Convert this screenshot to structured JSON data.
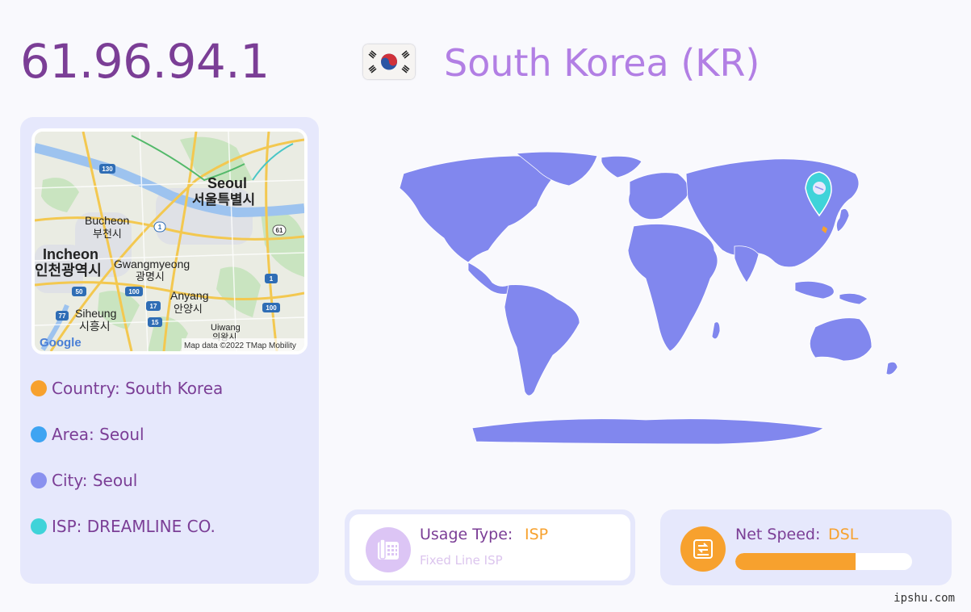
{
  "header": {
    "ip": "61.96.94.1",
    "country_title": "South Korea (KR)",
    "flag_icon": "south-korea-flag-icon"
  },
  "mini_map": {
    "labels": {
      "seoul": "Seoul",
      "seoul_kr": "서울특별시",
      "bucheon": "Bucheon",
      "bucheon_kr": "부천시",
      "incheon": "Incheon",
      "incheon_kr": "인천광역시",
      "gwangmyeong": "Gwangmyeong",
      "gwangmyeong_kr": "광명시",
      "anyang": "Anyang",
      "anyang_kr": "안양시",
      "siheung": "Siheung",
      "siheung_kr": "시흥시",
      "uiwang": "Uiwang",
      "uiwang_kr": "의왕시"
    },
    "route_shields": [
      "130",
      "1",
      "61",
      "1",
      "50",
      "100",
      "17",
      "100",
      "77",
      "15"
    ],
    "logo": "Google",
    "attribution": "Map data ©2022 TMap Mobility"
  },
  "info": {
    "country": "Country: South Korea",
    "area": "Area: Seoul",
    "city": "City: Seoul",
    "isp": "ISP: DREAMLINE CO."
  },
  "usage": {
    "label": "Usage Type:",
    "value": "ISP",
    "sub": "Fixed Line ISP",
    "icon": "phone-icon"
  },
  "speed": {
    "label": "Net Speed:",
    "value": "DSL",
    "level_fraction": 0.68,
    "icon": "hard-drive-icon"
  },
  "colors": {
    "accent_purple": "#7b3e96",
    "title_lilac": "#b27fe4",
    "orange": "#f7a12e",
    "area_blue": "#3ea4f2",
    "city_periwinkle": "#8a91ef",
    "isp_teal": "#3fd3d9",
    "map_land": "#8187ee"
  },
  "footer": {
    "site": "ipshu.com"
  }
}
